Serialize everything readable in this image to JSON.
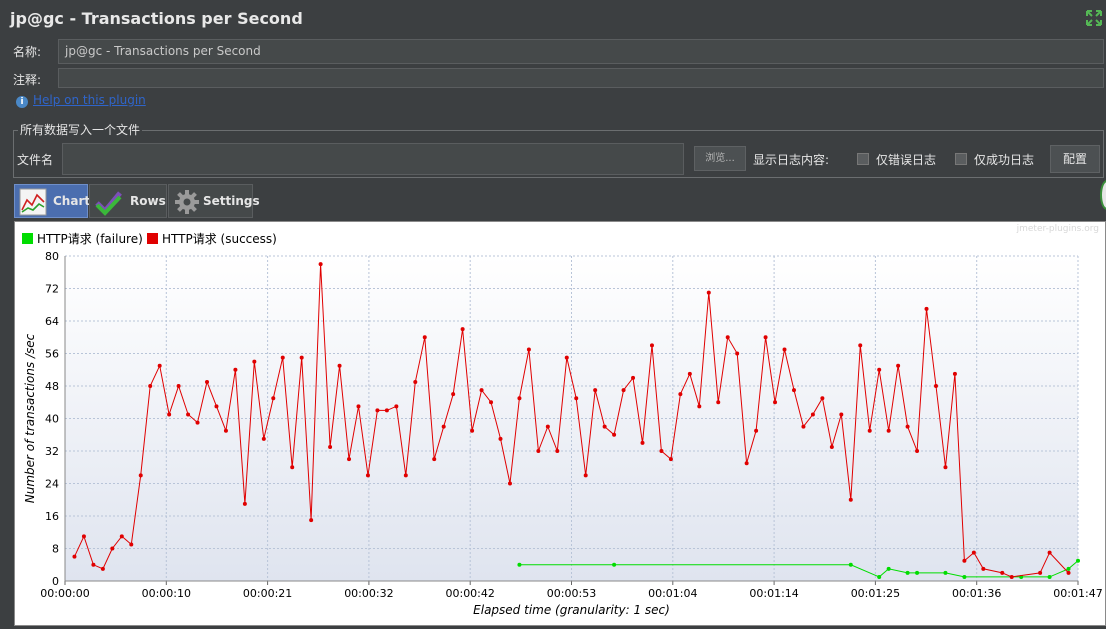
{
  "window": {
    "title": "jp@gc - Transactions per Second"
  },
  "form": {
    "name_label": "名称:",
    "name_value": "jp@gc - Transactions per Second",
    "comment_label": "注释:",
    "comment_value": "",
    "help_link": "Help on this plugin"
  },
  "file_section": {
    "legend": "所有数据写入一个文件",
    "filename_label": "文件名",
    "filename_value": "",
    "browse_button": "浏览...",
    "log_label": "显示日志内容:",
    "errors_only_label": "仅错误日志",
    "success_only_label": "仅成功日志",
    "config_button": "配置"
  },
  "tabs": [
    {
      "label": "Chart",
      "icon": "chart-icon",
      "active": true
    },
    {
      "label": "Rows",
      "icon": "checkmark-icon",
      "active": false
    },
    {
      "label": "Settings",
      "icon": "gear-icon",
      "active": false
    }
  ],
  "chart": {
    "watermark": "jmeter-plugins.org"
  },
  "colors": {
    "success": "#e00000",
    "failure": "#00dd00",
    "accent": "#4b6eaf"
  },
  "chart_data": {
    "type": "line",
    "title": "",
    "xlabel": "Elapsed time (granularity: 1 sec)",
    "ylabel": "Number of transactions /sec",
    "ylim": [
      0,
      80
    ],
    "xlim": [
      0,
      107
    ],
    "x_unit": "seconds",
    "y_ticks": [
      "0",
      "8",
      "16",
      "24",
      "32",
      "40",
      "48",
      "56",
      "64",
      "72",
      "80"
    ],
    "x_ticks": [
      "00:00:00",
      "00:00:10",
      "00:00:21",
      "00:00:32",
      "00:00:42",
      "00:00:53",
      "00:01:04",
      "00:01:14",
      "00:01:25",
      "00:01:36",
      "00:01:47"
    ],
    "grid": true,
    "legend_position": "top-left",
    "series": [
      {
        "name": "HTTP请求 (failure)",
        "color": "#00dd00",
        "points": [
          [
            48,
            4
          ],
          [
            58,
            4
          ],
          [
            83,
            4
          ],
          [
            86,
            1
          ],
          [
            87,
            3
          ],
          [
            89,
            2
          ],
          [
            90,
            2
          ],
          [
            93,
            2
          ],
          [
            95,
            1
          ],
          [
            101,
            1
          ],
          [
            104,
            1
          ],
          [
            106,
            3
          ],
          [
            107,
            5
          ]
        ]
      },
      {
        "name": "HTTP请求 (success)",
        "color": "#e00000",
        "points": [
          [
            1,
            6
          ],
          [
            2,
            11
          ],
          [
            3,
            4
          ],
          [
            4,
            3
          ],
          [
            5,
            8
          ],
          [
            6,
            11
          ],
          [
            7,
            9
          ],
          [
            8,
            26
          ],
          [
            9,
            48
          ],
          [
            10,
            53
          ],
          [
            11,
            41
          ],
          [
            12,
            48
          ],
          [
            13,
            41
          ],
          [
            14,
            39
          ],
          [
            15,
            49
          ],
          [
            16,
            43
          ],
          [
            17,
            37
          ],
          [
            18,
            52
          ],
          [
            19,
            19
          ],
          [
            20,
            54
          ],
          [
            21,
            35
          ],
          [
            22,
            45
          ],
          [
            23,
            55
          ],
          [
            24,
            28
          ],
          [
            25,
            55
          ],
          [
            26,
            15
          ],
          [
            27,
            78
          ],
          [
            28,
            33
          ],
          [
            29,
            53
          ],
          [
            30,
            30
          ],
          [
            31,
            43
          ],
          [
            32,
            26
          ],
          [
            33,
            42
          ],
          [
            34,
            42
          ],
          [
            35,
            43
          ],
          [
            36,
            26
          ],
          [
            37,
            49
          ],
          [
            38,
            60
          ],
          [
            39,
            30
          ],
          [
            40,
            38
          ],
          [
            41,
            46
          ],
          [
            42,
            62
          ],
          [
            43,
            37
          ],
          [
            44,
            47
          ],
          [
            45,
            44
          ],
          [
            46,
            35
          ],
          [
            47,
            24
          ],
          [
            48,
            45
          ],
          [
            49,
            57
          ],
          [
            50,
            32
          ],
          [
            51,
            38
          ],
          [
            52,
            32
          ],
          [
            53,
            55
          ],
          [
            54,
            45
          ],
          [
            55,
            26
          ],
          [
            56,
            47
          ],
          [
            57,
            38
          ],
          [
            58,
            36
          ],
          [
            59,
            47
          ],
          [
            60,
            50
          ],
          [
            61,
            34
          ],
          [
            62,
            58
          ],
          [
            63,
            32
          ],
          [
            64,
            30
          ],
          [
            65,
            46
          ],
          [
            66,
            51
          ],
          [
            67,
            43
          ],
          [
            68,
            71
          ],
          [
            69,
            44
          ],
          [
            70,
            60
          ],
          [
            71,
            56
          ],
          [
            72,
            29
          ],
          [
            73,
            37
          ],
          [
            74,
            60
          ],
          [
            75,
            44
          ],
          [
            76,
            57
          ],
          [
            77,
            47
          ],
          [
            78,
            38
          ],
          [
            79,
            41
          ],
          [
            80,
            45
          ],
          [
            81,
            33
          ],
          [
            82,
            41
          ],
          [
            83,
            20
          ],
          [
            84,
            58
          ],
          [
            85,
            37
          ],
          [
            86,
            52
          ],
          [
            87,
            37
          ],
          [
            88,
            53
          ],
          [
            89,
            38
          ],
          [
            90,
            32
          ],
          [
            91,
            67
          ],
          [
            92,
            48
          ],
          [
            93,
            28
          ],
          [
            94,
            51
          ],
          [
            95,
            5
          ],
          [
            96,
            7
          ],
          [
            97,
            3
          ],
          [
            99,
            2
          ],
          [
            100,
            1
          ],
          [
            103,
            2
          ],
          [
            104,
            7
          ],
          [
            106,
            2
          ]
        ]
      }
    ]
  }
}
